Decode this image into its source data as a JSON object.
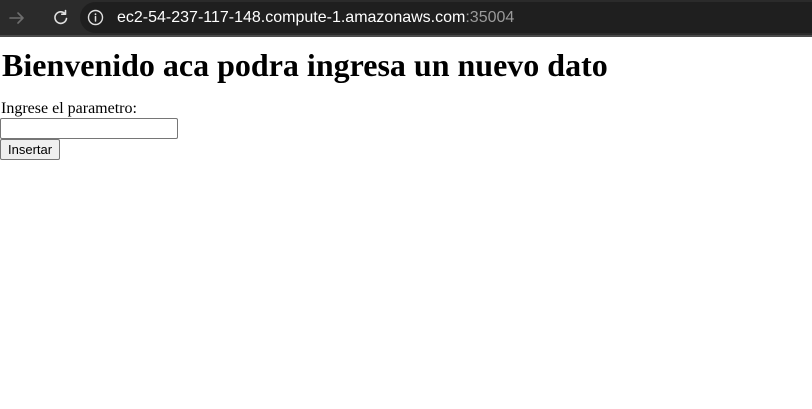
{
  "browser": {
    "url_host": "ec2-54-237-117-148.compute-1.amazonaws.com",
    "url_port": ":35004",
    "icons": {
      "forward": "arrow-right-icon",
      "reload": "reload-icon",
      "site_info": "info-icon"
    }
  },
  "page": {
    "heading": "Bienvenido aca podra ingresa un nuevo dato",
    "form": {
      "label": "Ingrese el parametro:",
      "input_value": "",
      "submit_label": "Insertar"
    }
  }
}
